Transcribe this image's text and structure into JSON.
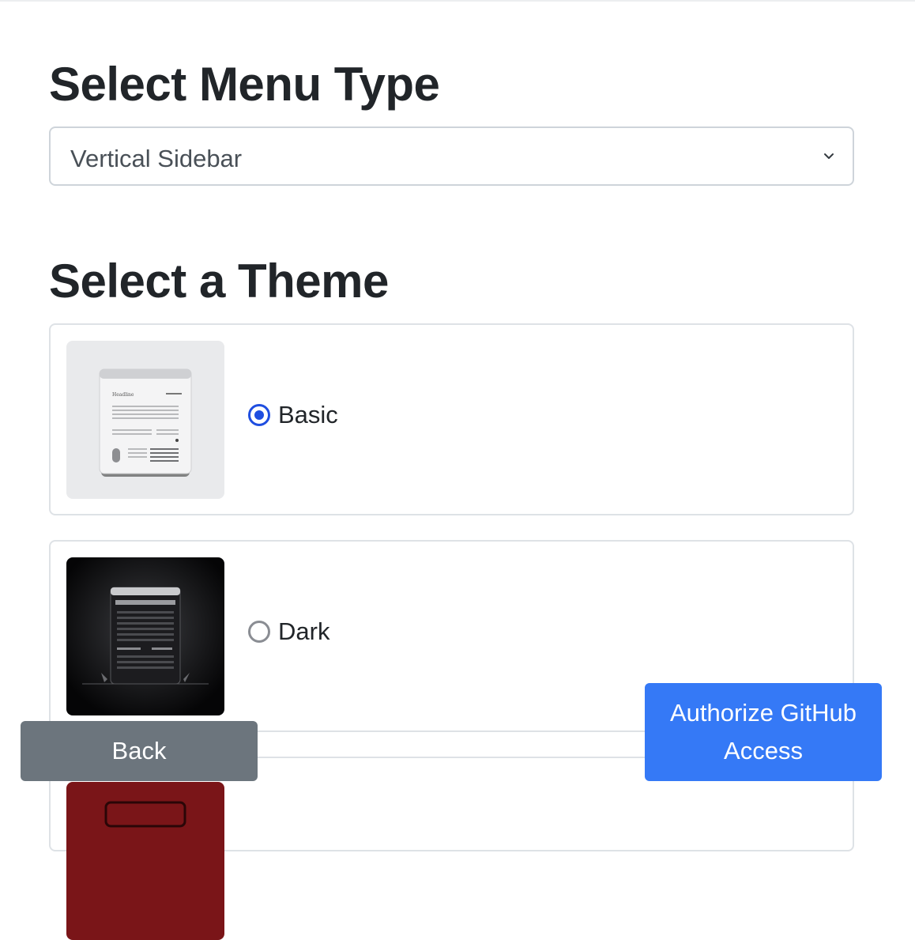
{
  "menu_section": {
    "heading": "Select Menu Type",
    "select": {
      "value": "Vertical Sidebar",
      "chevron_icon": "chevron-down-icon"
    }
  },
  "theme_section": {
    "heading": "Select a Theme",
    "themes": [
      {
        "label": "Basic",
        "selected": true,
        "thumbnail": "light-browser-mockup-image"
      },
      {
        "label": "Dark",
        "selected": false,
        "thumbnail": "dark-browser-mockup-image"
      },
      {
        "label": "",
        "selected": false,
        "thumbnail": "red-theme-image"
      }
    ]
  },
  "actions": {
    "back_label": "Back",
    "authorize_label": "Authorize GitHub Access"
  },
  "colors": {
    "primary": "#3579f6",
    "secondary": "#6c757d",
    "radio_checked": "#1f4ee0"
  }
}
